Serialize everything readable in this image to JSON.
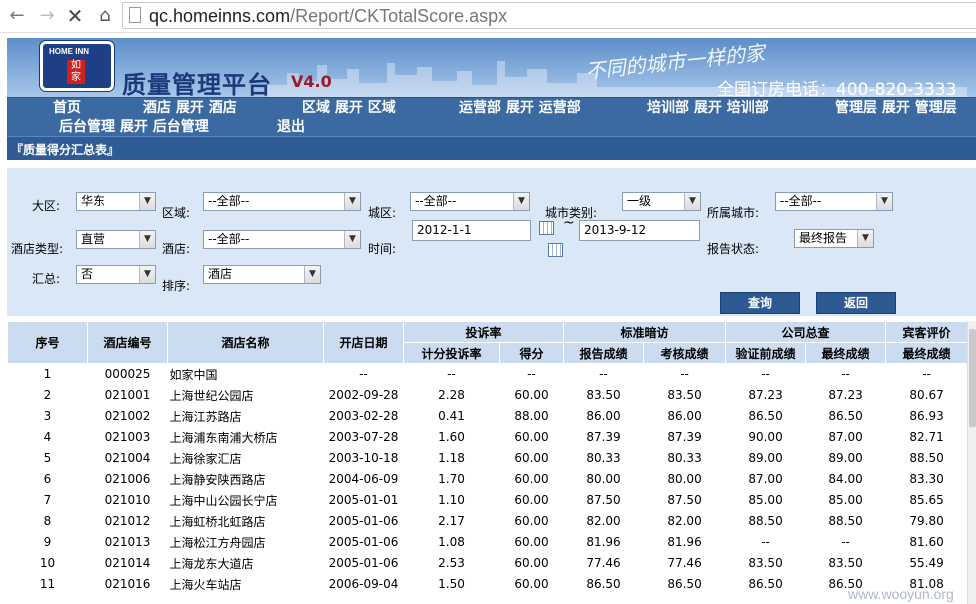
{
  "browser": {
    "url_host": "qc.homeinns.com",
    "url_path": "/Report/CKTotalScore.aspx"
  },
  "banner": {
    "logo_top": "HOME INN",
    "logo_mid": "如家",
    "title": "质量管理平台",
    "version": "V4.0",
    "slogan": "不同的城市一样的家",
    "hotline": "全国订房电话：400-820-3333"
  },
  "menu": {
    "row1": [
      "首页",
      "酒店 展开 酒店",
      "区域 展开 区域",
      "运营部 展开 运营部",
      "培训部 展开 培训部",
      "管理层 展开 管理层"
    ],
    "row2": [
      "后台管理 展开 后台管理",
      "退出"
    ]
  },
  "page_title": "『质量得分汇总表』",
  "filters": {
    "region_label": "大区:",
    "region_value": "华东",
    "area_label": "区域:",
    "area_value": "--全部--",
    "city_label": "城区:",
    "city_value": "--全部--",
    "city_type_label": "城市类别:",
    "city_type_value": "一级",
    "owner_city_label": "所属城市:",
    "owner_city_value": "--全部--",
    "hotel_type_label": "酒店类型:",
    "hotel_type_value": "直营",
    "hotel_label": "酒店:",
    "hotel_value": "--全部--",
    "time_label": "时间:",
    "date_from": "2012-1-1",
    "date_tilde": "~",
    "date_to": "2013-9-12",
    "report_status_label": "报告状态:",
    "report_status_value": "最终报告",
    "summary_label": "汇总:",
    "summary_value": "否",
    "sort_label": "排序:",
    "sort_value": "酒店",
    "query_button": "查询",
    "back_button": "返回"
  },
  "table": {
    "head_main": [
      "序号",
      "酒店编号",
      "酒店名称",
      "开店日期"
    ],
    "groups": [
      "投诉率",
      "标准暗访",
      "公司总查",
      "宾客评价"
    ],
    "sub": [
      "计分投诉率",
      "得分",
      "报告成绩",
      "考核成绩",
      "验证前成绩",
      "最终成绩",
      "最终成绩"
    ],
    "rows": [
      [
        "1",
        "000025",
        "如家中国",
        "--",
        "--",
        "--",
        "--",
        "--",
        "--",
        "--",
        "--"
      ],
      [
        "2",
        "021001",
        "上海世纪公园店",
        "2002-09-28",
        "2.28",
        "60.00",
        "83.50",
        "83.50",
        "87.23",
        "87.23",
        "80.67"
      ],
      [
        "3",
        "021002",
        "上海江苏路店",
        "2003-02-28",
        "0.41",
        "88.00",
        "86.00",
        "86.00",
        "86.50",
        "86.50",
        "86.93"
      ],
      [
        "4",
        "021003",
        "上海浦东南浦大桥店",
        "2003-07-28",
        "1.60",
        "60.00",
        "87.39",
        "87.39",
        "90.00",
        "87.00",
        "82.71"
      ],
      [
        "5",
        "021004",
        "上海徐家汇店",
        "2003-10-18",
        "1.18",
        "60.00",
        "80.33",
        "80.33",
        "89.00",
        "89.00",
        "88.50"
      ],
      [
        "6",
        "021006",
        "上海静安陕西路店",
        "2004-06-09",
        "1.70",
        "60.00",
        "80.00",
        "80.00",
        "87.00",
        "84.00",
        "83.30"
      ],
      [
        "7",
        "021010",
        "上海中山公园长宁店",
        "2005-01-01",
        "1.10",
        "60.00",
        "87.50",
        "87.50",
        "85.00",
        "85.00",
        "85.65"
      ],
      [
        "8",
        "021012",
        "上海虹桥北虹路店",
        "2005-01-06",
        "2.17",
        "60.00",
        "82.00",
        "82.00",
        "88.50",
        "88.50",
        "79.80"
      ],
      [
        "9",
        "021013",
        "上海松江方舟园店",
        "2005-01-06",
        "1.08",
        "60.00",
        "81.96",
        "81.96",
        "--",
        "--",
        "81.60"
      ],
      [
        "10",
        "021014",
        "上海龙东大道店",
        "2005-01-06",
        "2.53",
        "60.00",
        "77.46",
        "77.46",
        "83.50",
        "83.50",
        "55.49"
      ],
      [
        "11",
        "021016",
        "上海火车站店",
        "2006-09-04",
        "1.50",
        "60.00",
        "86.50",
        "86.50",
        "86.50",
        "86.50",
        "81.08"
      ]
    ]
  },
  "watermark": "www.wooyun.org"
}
